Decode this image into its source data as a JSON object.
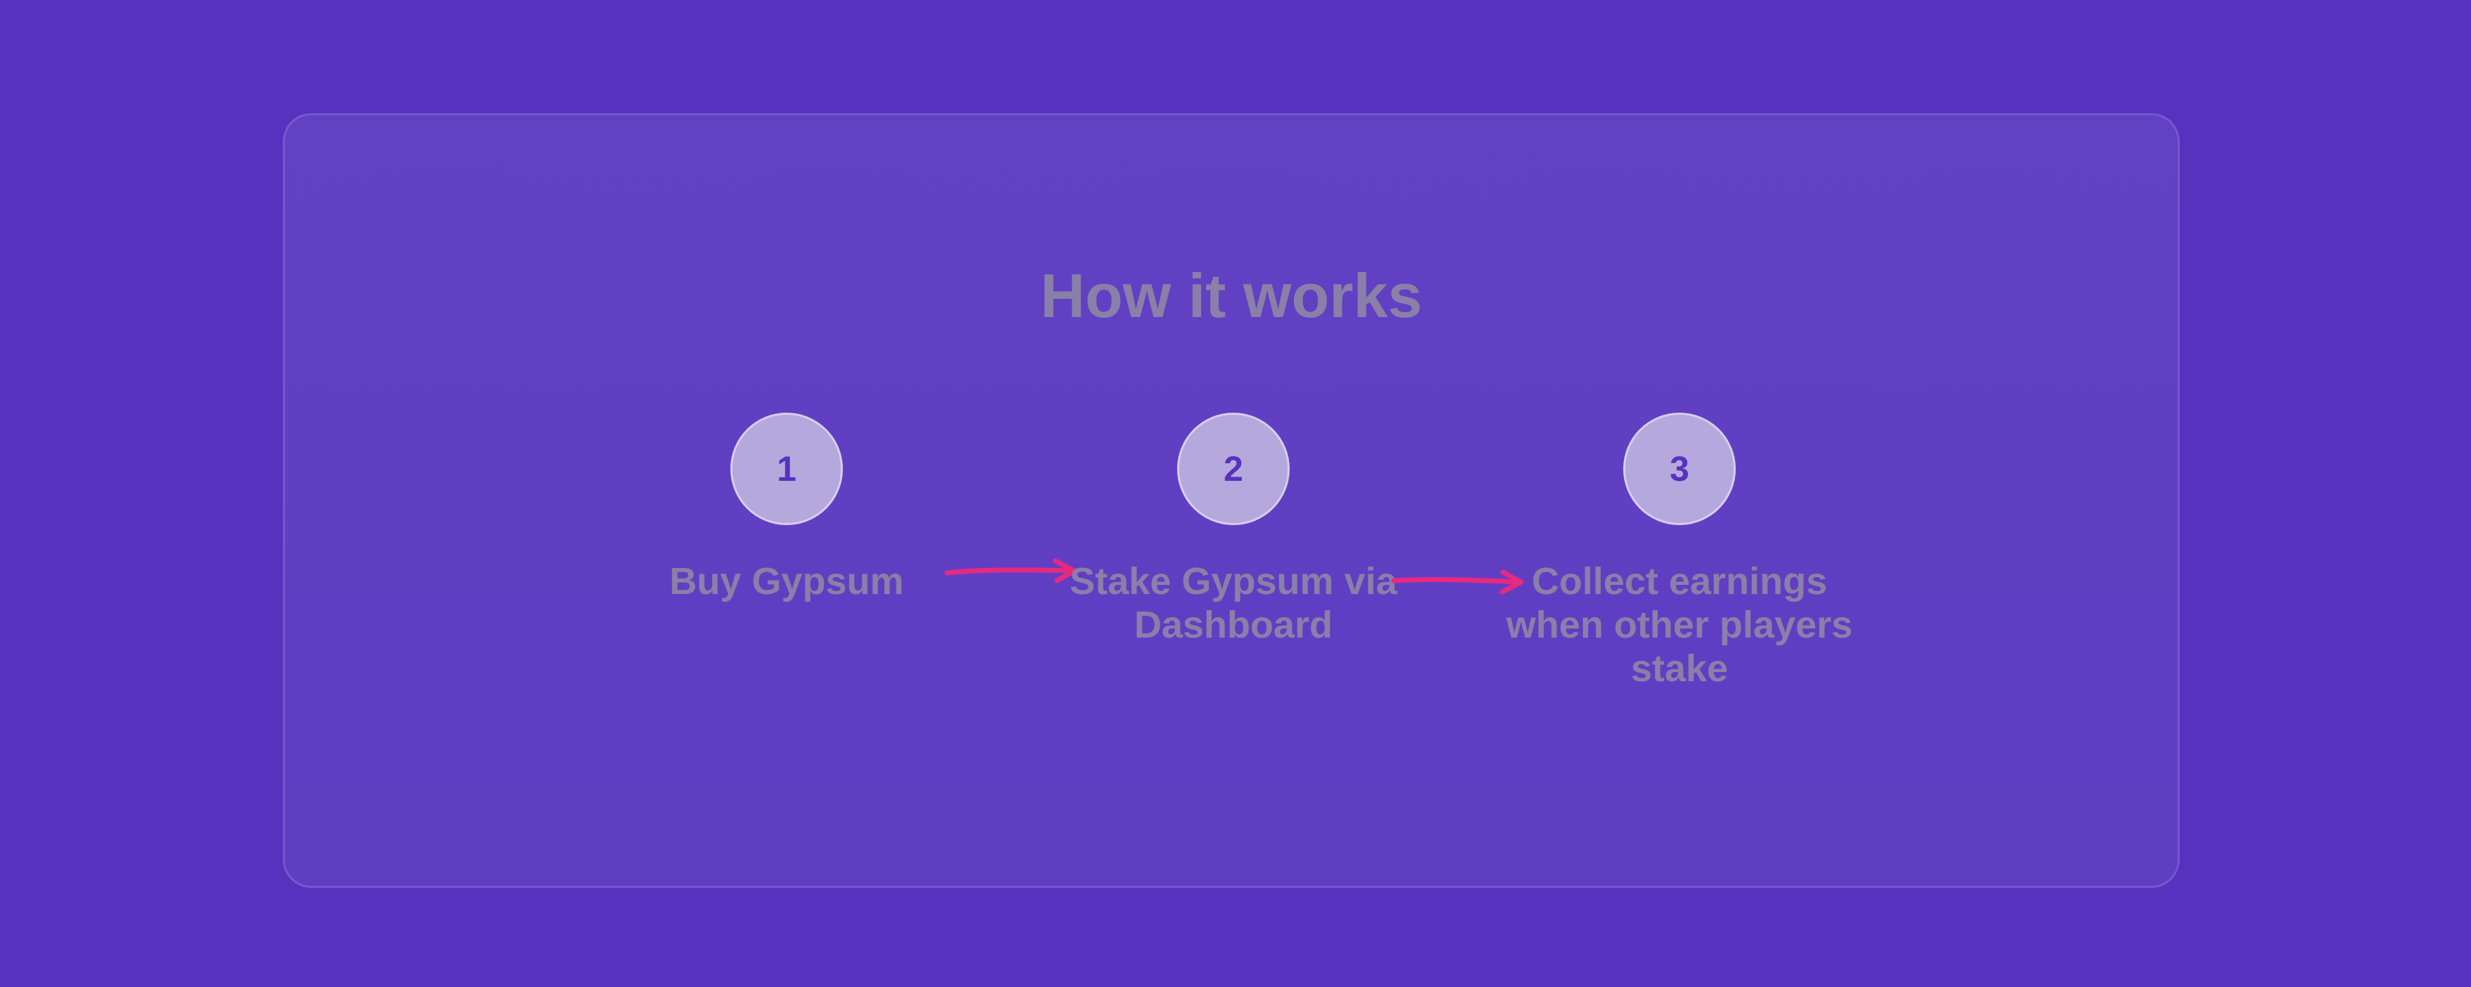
{
  "section": {
    "title": "How it works"
  },
  "steps": [
    {
      "number": "1",
      "label": "Buy Gypsum"
    },
    {
      "number": "2",
      "label": "Stake Gypsum via Dashboard"
    },
    {
      "number": "3",
      "label": "Collect earnings when other players stake"
    }
  ],
  "colors": {
    "background": "#5632bf",
    "circle_fill": "#b4a8dd",
    "circle_text": "#5632bf",
    "label_text": "#8a7fa8",
    "arrow": "#e62a7f"
  },
  "icons": {
    "step_connector": "arrow-right-icon"
  }
}
